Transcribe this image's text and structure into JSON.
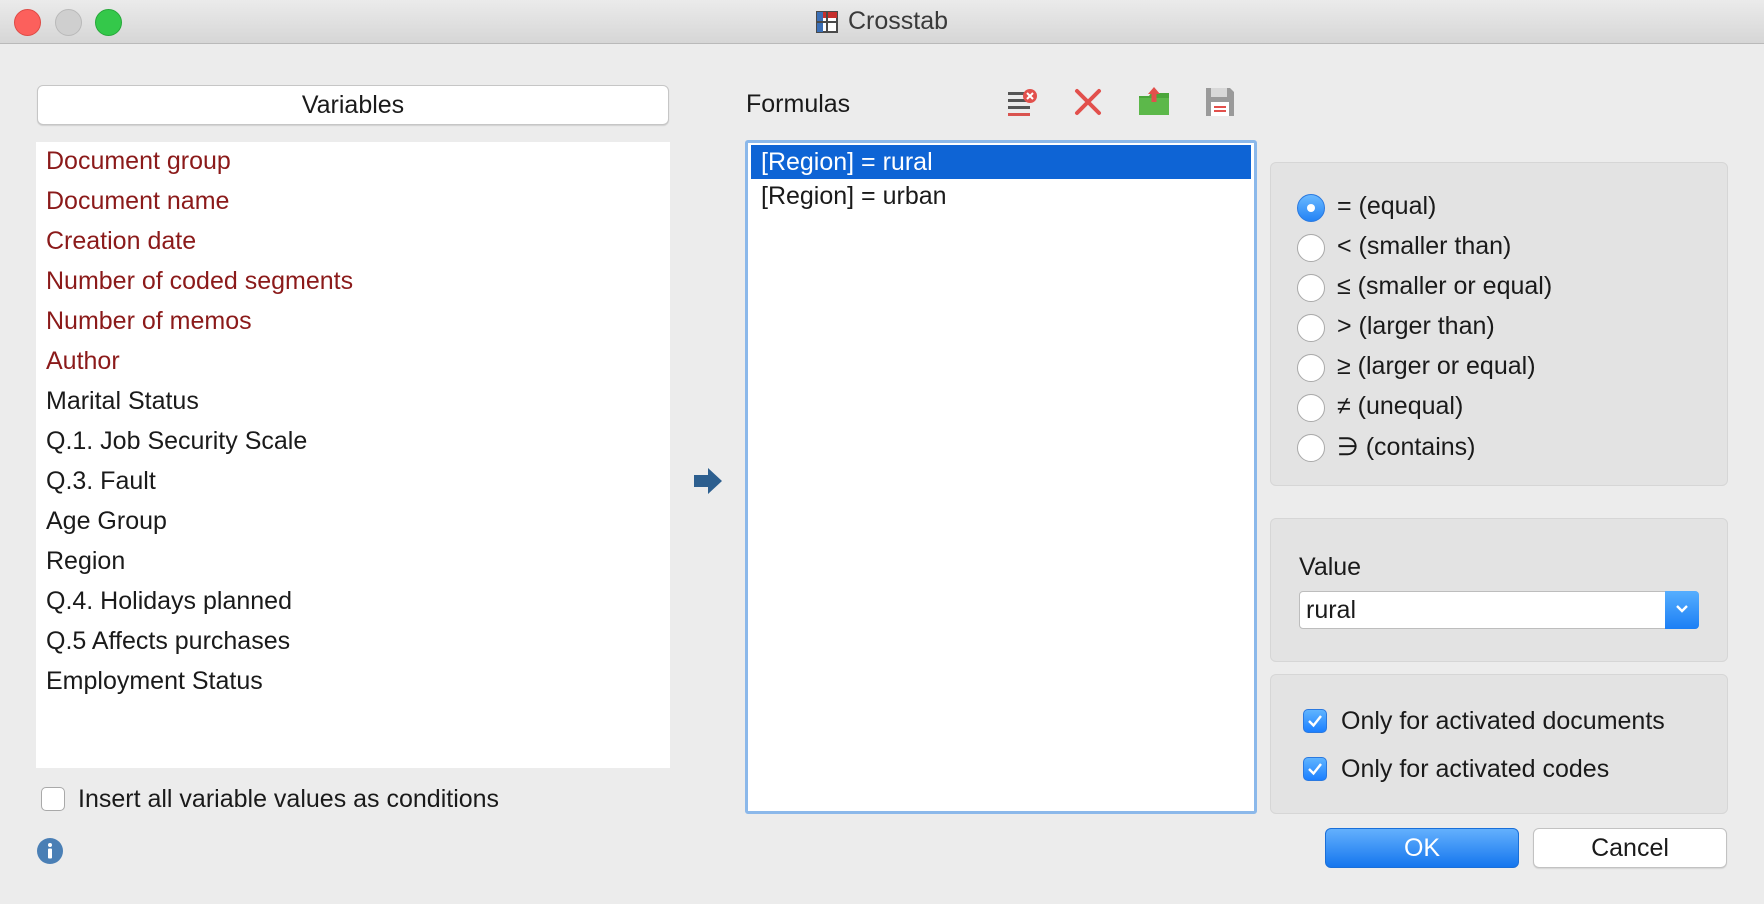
{
  "window": {
    "title": "Crosstab",
    "title_icon": "crosstab-table-icon"
  },
  "variables": {
    "header": "Variables",
    "items": [
      {
        "label": "Document group",
        "kind": "system"
      },
      {
        "label": "Document name",
        "kind": "system"
      },
      {
        "label": "Creation date",
        "kind": "system"
      },
      {
        "label": "Number of coded segments",
        "kind": "system"
      },
      {
        "label": "Number of memos",
        "kind": "system"
      },
      {
        "label": "Author",
        "kind": "system"
      },
      {
        "label": "Marital Status",
        "kind": "user"
      },
      {
        "label": "Q.1. Job Security Scale",
        "kind": "user"
      },
      {
        "label": "Q.3. Fault",
        "kind": "user"
      },
      {
        "label": "Age Group",
        "kind": "user"
      },
      {
        "label": "Region",
        "kind": "user"
      },
      {
        "label": "Q.4. Holidays planned",
        "kind": "user"
      },
      {
        "label": "Q.5 Affects purchases",
        "kind": "user"
      },
      {
        "label": "Employment Status",
        "kind": "user"
      }
    ],
    "insert_all_checkbox": {
      "label": "Insert all variable values as conditions",
      "checked": false
    }
  },
  "formulas": {
    "label": "Formulas",
    "toolbar": [
      "clear-list-icon",
      "delete-icon",
      "load-icon",
      "save-icon"
    ],
    "items": [
      {
        "text": "[Region] = rural",
        "selected": true
      },
      {
        "text": "[Region] = urban",
        "selected": false
      }
    ]
  },
  "operators": [
    {
      "label": "= (equal)",
      "selected": true
    },
    {
      "label": "< (smaller than)",
      "selected": false
    },
    {
      "label": "≤ (smaller or equal)",
      "selected": false
    },
    {
      "label": "> (larger than)",
      "selected": false
    },
    {
      "label": "≥ (larger or equal)",
      "selected": false
    },
    {
      "label": "≠ (unequal)",
      "selected": false
    },
    {
      "label": "∋ (contains)",
      "selected": false
    }
  ],
  "value": {
    "label": "Value",
    "selected": "rural"
  },
  "options": {
    "activated_documents": {
      "label": "Only for activated documents",
      "checked": true
    },
    "activated_codes": {
      "label": "Only for activated codes",
      "checked": true
    }
  },
  "buttons": {
    "ok": "OK",
    "cancel": "Cancel"
  },
  "colors": {
    "system_variable": "#8b1a1a",
    "selection": "#0e64d5",
    "accent": "#1b7fff"
  }
}
